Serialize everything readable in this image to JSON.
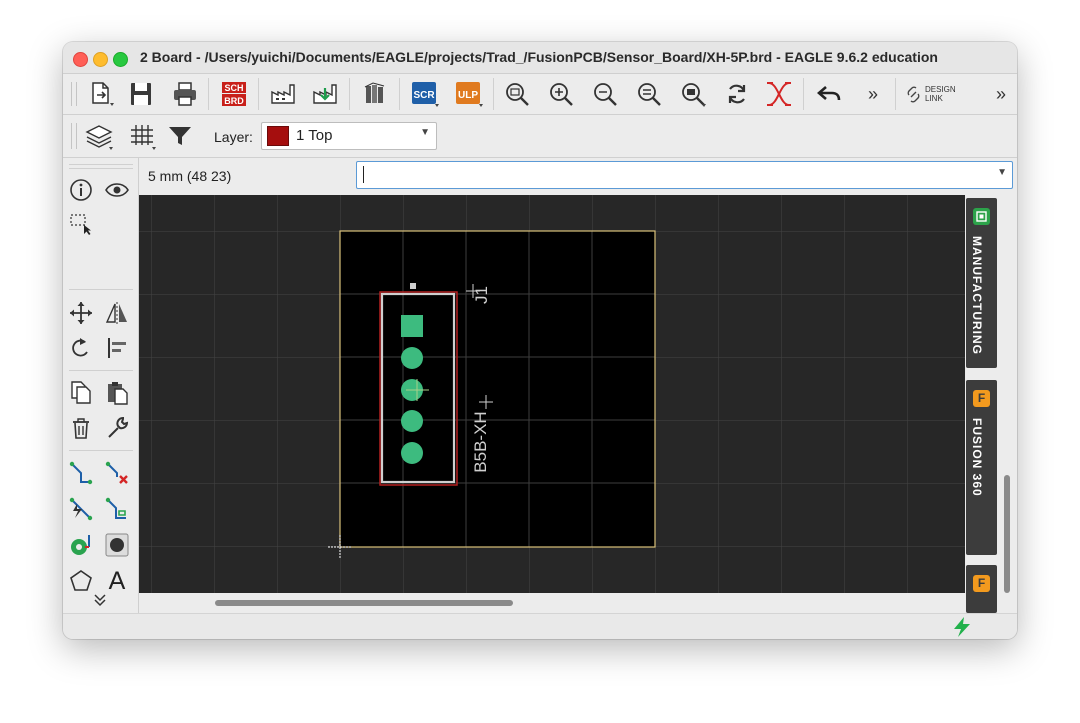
{
  "window": {
    "title": "2 Board - /Users/yuichi/Documents/EAGLE/projects/Trad_/FusionPCB/Sensor_Board/XH-5P.brd - EAGLE 9.6.2 education"
  },
  "toolbar": {
    "sch_brd_top": "SCH",
    "sch_brd_bottom": "BRD",
    "scr_label": "SCR",
    "ulp_label": "ULP",
    "overflow_label": "»",
    "design_link_top": "DESIGN",
    "design_link_bottom": "LINK",
    "overflow2_label": "»"
  },
  "layer": {
    "label": "Layer:",
    "selected": "1 Top",
    "color": "#a50e0e"
  },
  "coordinate_display": "5 mm (48 23)",
  "command_line": {
    "value": ""
  },
  "board": {
    "part_name": "J1",
    "part_value": "B5B-XH",
    "outline_color": "#d9c07a",
    "pad_color": "#3dbb7f",
    "silk_color": "#cfcfcf",
    "keepout_color": "#b42020"
  },
  "right_panel": {
    "manufacturing_label": "MANUFACTURING",
    "fusion_label": "FUSION 360",
    "fusion_letter_1": "F",
    "fusion_letter_2": "F"
  },
  "left_toolbar": {
    "text_tool": "A",
    "more": "⌄"
  }
}
